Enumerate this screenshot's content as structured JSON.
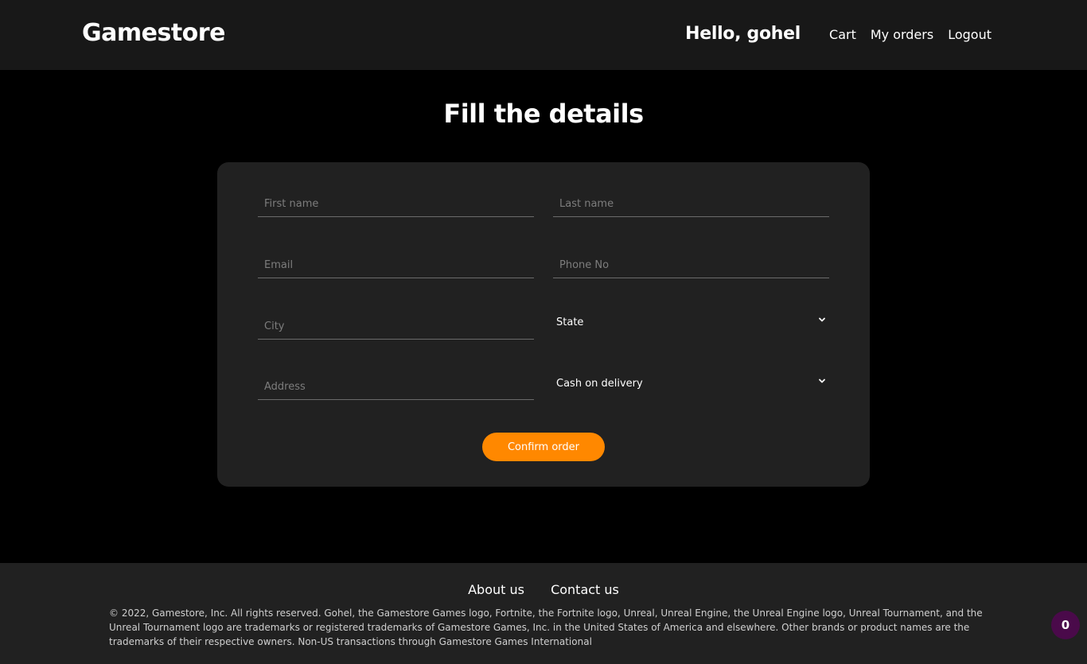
{
  "header": {
    "brand": "Gamestore",
    "greeting": "Hello, gohel",
    "links": [
      "Cart",
      "My orders",
      "Logout"
    ]
  },
  "page_title": "Fill the details",
  "form": {
    "first_name_placeholder": "First name",
    "last_name_placeholder": "Last name",
    "email_placeholder": "Email",
    "phone_placeholder": "Phone No",
    "city_placeholder": "City",
    "state_value": "State",
    "address_placeholder": "Address",
    "payment_value": "Cash on delivery",
    "confirm_label": "Confirm order"
  },
  "footer": {
    "links": [
      "About us",
      "Contact us"
    ],
    "legal": "© 2022, Gamestore, Inc. All rights reserved. Gohel, the Gamestore Games logo, Fortnite, the Fortnite logo, Unreal, Unreal Engine, the Unreal Engine logo, Unreal Tournament, and the Unreal Tournament logo are trademarks or registered trademarks of Gamestore Games, Inc. in the United States of America and elsewhere. Other brands or product names are the trademarks of their respective owners. Non-US transactions through Gamestore Games International"
  },
  "badge_count": "0",
  "colors": {
    "accent": "#ff8800",
    "header_bg": "#181818",
    "card_bg": "#212121",
    "badge_bg": "#4a0a4a"
  },
  "icons": [
    "chevron-down-icon"
  ]
}
